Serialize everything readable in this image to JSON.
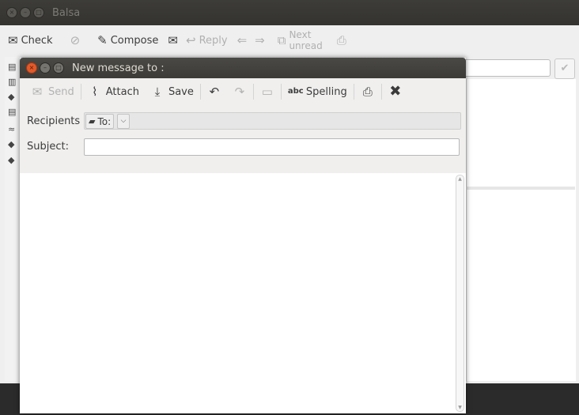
{
  "main_window": {
    "title": "Balsa",
    "toolbar": {
      "check": "Check",
      "compose": "Compose",
      "reply": "Reply",
      "next_unread_line1": "Next",
      "next_unread_line2": "unread"
    }
  },
  "compose": {
    "title": "New message to :",
    "toolbar": {
      "send": "Send",
      "attach": "Attach",
      "save": "Save",
      "spelling": "Spelling"
    },
    "fields": {
      "recipients_label": "Recipients",
      "to_label": "To:",
      "to_value": "",
      "subject_label": "Subject:",
      "subject_value": ""
    },
    "body_text": ""
  }
}
